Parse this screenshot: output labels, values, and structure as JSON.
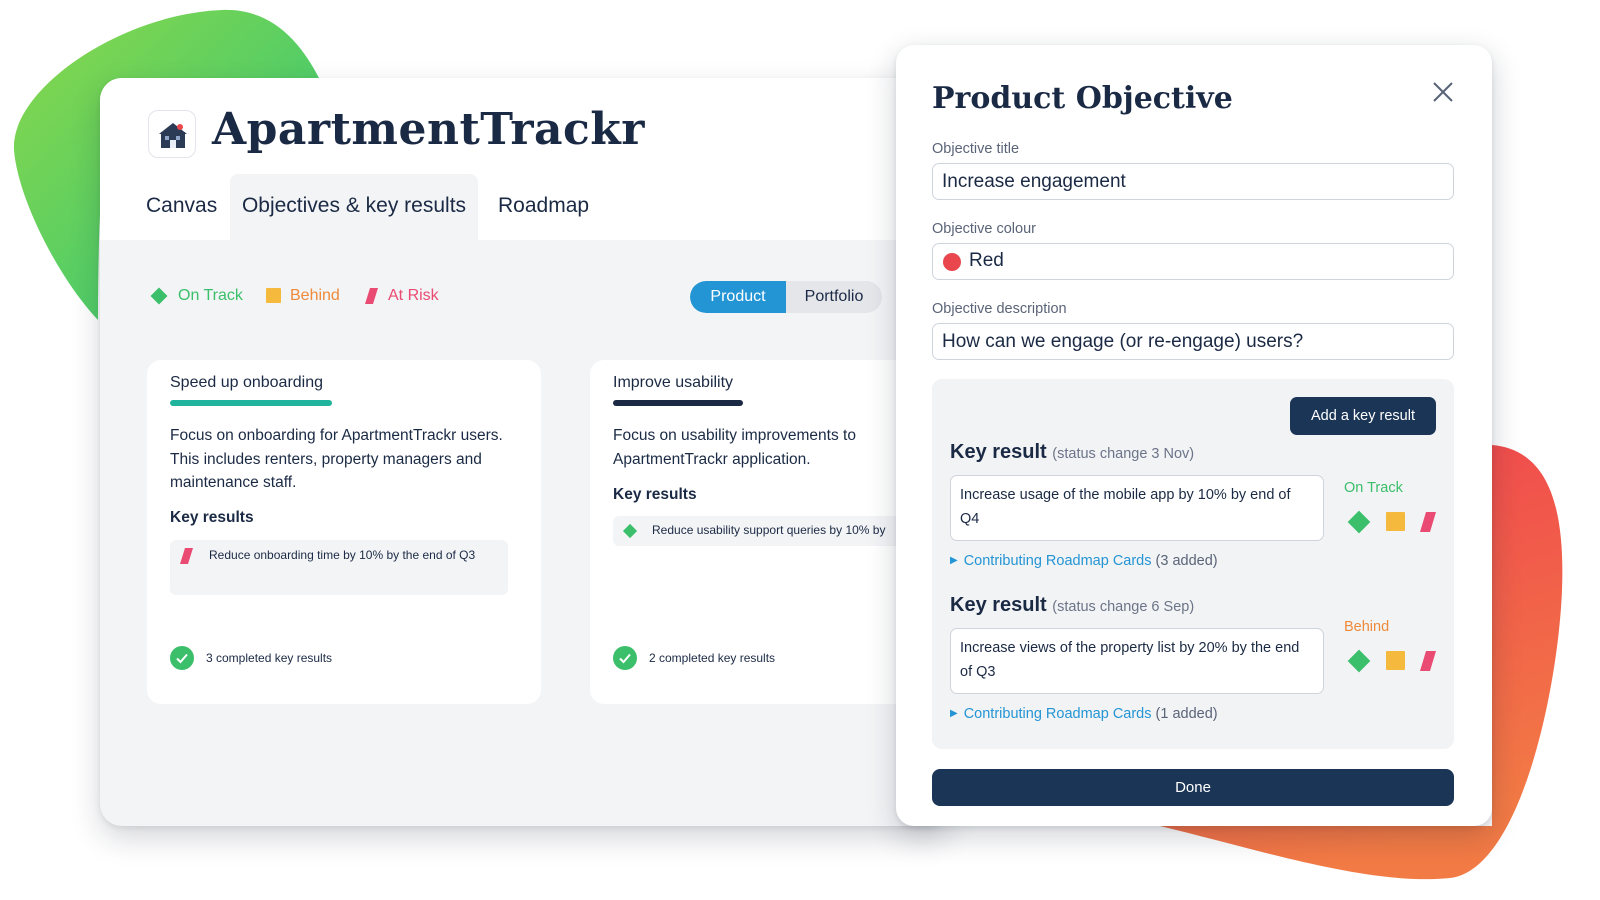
{
  "app": {
    "title": "ApartmentTrackr",
    "tabs": [
      {
        "label": "Canvas",
        "active": false
      },
      {
        "label": "Objectives & key results",
        "active": true
      },
      {
        "label": "Roadmap",
        "active": false
      }
    ]
  },
  "legend": {
    "on_track": "On Track",
    "behind": "Behind",
    "at_risk": "At Risk"
  },
  "view_toggle": {
    "options": [
      "Product",
      "Portfolio"
    ],
    "selected": "Product"
  },
  "objectives": [
    {
      "title": "Speed up onboarding",
      "description": "Focus on onboarding for ApartmentTrackr users. This includes renters, property managers and maintenance staff.",
      "key_results_heading": "Key results",
      "key_results": [
        {
          "status": "At Risk",
          "text": "Reduce onboarding time by 10% by the end of Q3"
        }
      ],
      "completed": "3 completed key results"
    },
    {
      "title": "Improve usability",
      "description": "Focus on usability improvements to ApartmentTrackr application.",
      "key_results_heading": "Key results",
      "key_results": [
        {
          "status": "On Track",
          "text": "Reduce usability support queries by 10% by"
        }
      ],
      "completed": "2 completed key results"
    }
  ],
  "dialog": {
    "title": "Product Objective",
    "fields": {
      "objective_title_label": "Objective title",
      "objective_title_value": "Increase engagement",
      "objective_colour_label": "Objective colour",
      "objective_colour_value": "Red",
      "objective_description_label": "Objective description",
      "objective_description_value": "How can we engage (or re-engage) users?"
    },
    "add_key_result_label": "Add a key result",
    "key_results": [
      {
        "heading": "Key result",
        "status_change": "(status change 3 Nov)",
        "text": "Increase usage of the mobile app by 10% by end of Q4",
        "status": "On Track",
        "contributing_label": "Contributing Roadmap Cards",
        "contributing_count": "(3 added)"
      },
      {
        "heading": "Key result",
        "status_change": "(status change 6 Sep)",
        "text": "Increase views of the property list by 20% by the end of Q3",
        "status": "Behind",
        "contributing_label": "Contributing Roadmap Cards",
        "contributing_count": "(1 added)"
      }
    ],
    "done_label": "Done"
  },
  "colors": {
    "on_track": "#3bbf6a",
    "behind": "#f5b93e",
    "at_risk": "#ea4b72",
    "primary_blue": "#2495d4",
    "navy": "#1b3556",
    "objective_red": "#e9474d",
    "teal_underline": "#1fb49b",
    "navy_underline": "#1b2a44"
  }
}
